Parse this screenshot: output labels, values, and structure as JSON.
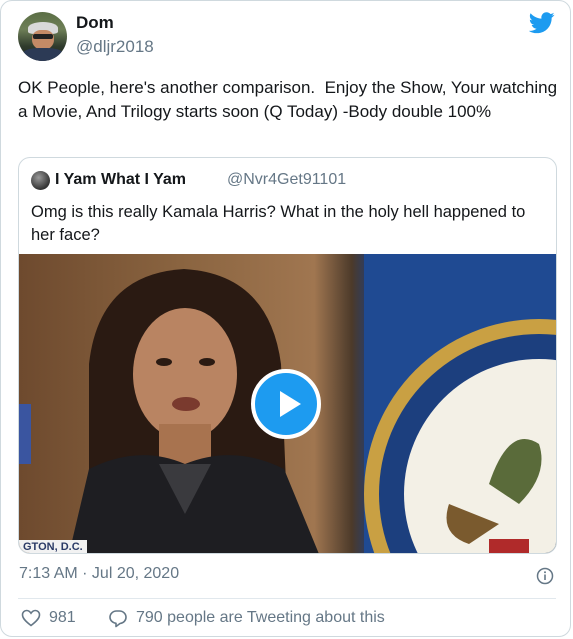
{
  "author": {
    "display_name": "Dom",
    "handle": "@dljr2018"
  },
  "tweet": {
    "text": "OK People, here's another comparison.  Enjoy the Show, Your watching a Movie, And Trilogy starts soon (Q Today) -Body double 100%"
  },
  "quoted_tweet": {
    "display_name": "I Yam What I Yam",
    "handle": "@Nvr4Get91101",
    "text": "Omg is this really Kamala Harris? What in the holy hell happened to her face?",
    "media": {
      "type": "video",
      "caption_strip": "GTON, D.C."
    }
  },
  "meta": {
    "timestamp": "7:13 AM · Jul 20, 2020"
  },
  "engagement": {
    "like_count": "981",
    "reply_text": "790 people are Tweeting about this"
  },
  "icons": {
    "brand": "twitter-bird-icon",
    "info": "info-icon",
    "like": "heart-icon",
    "reply": "speech-bubble-icon",
    "play": "play-icon"
  },
  "colors": {
    "accent": "#1d9bf0",
    "secondary_text": "#657786",
    "border": "#cfd9de"
  }
}
